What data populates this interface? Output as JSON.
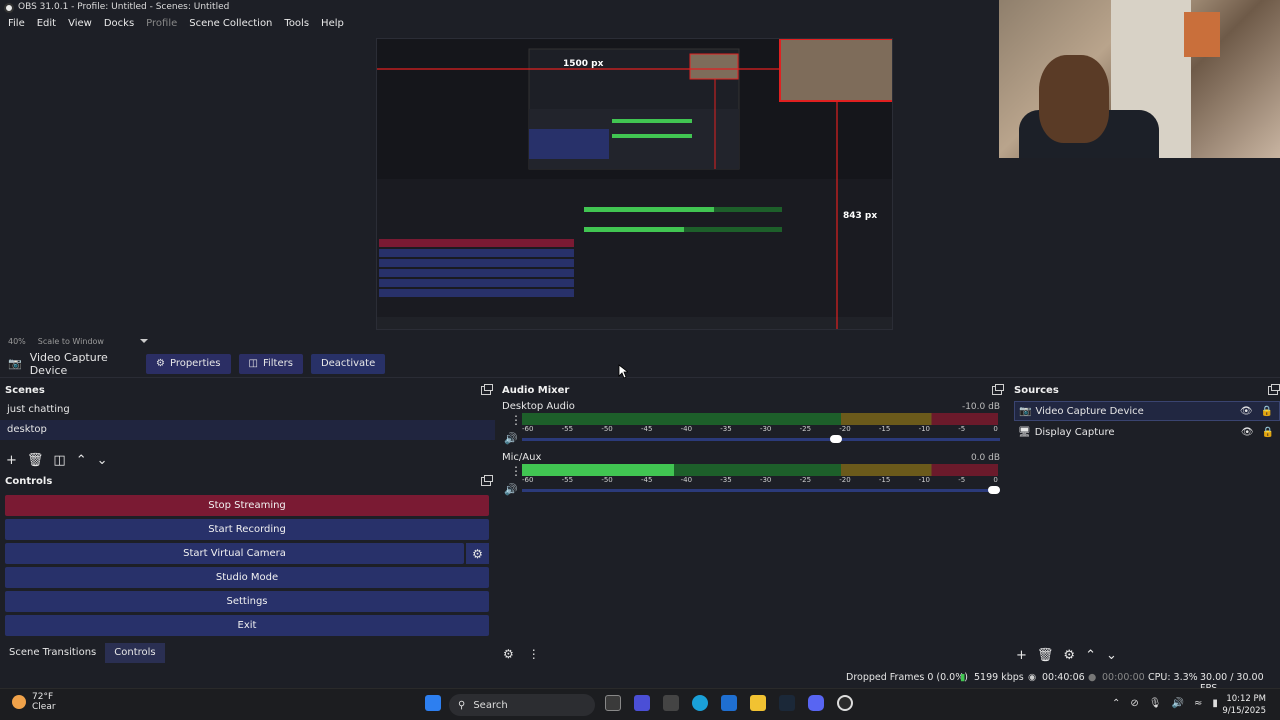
{
  "window": {
    "title": "OBS 31.0.1 - Profile: Untitled - Scenes: Untitled"
  },
  "menu": [
    "File",
    "Edit",
    "View",
    "Docks",
    "Profile",
    "Scene Collection",
    "Tools",
    "Help"
  ],
  "preview": {
    "zoom": "40%",
    "scale_mode": "Scale to Window",
    "mirror_labels": {
      "width": "1500 px",
      "height": "843 px"
    }
  },
  "source_toolbar": {
    "current_source": "Video Capture Device",
    "properties": "Properties",
    "filters": "Filters",
    "deactivate": "Deactivate"
  },
  "scenes": {
    "title": "Scenes",
    "items": [
      "just chatting",
      "desktop"
    ]
  },
  "controls": {
    "title": "Controls",
    "buttons": [
      "Stop Streaming",
      "Start Recording",
      "Start Virtual Camera",
      "Studio Mode",
      "Settings",
      "Exit"
    ]
  },
  "bottom_tabs": [
    "Scene Transitions",
    "Controls"
  ],
  "mixer": {
    "title": "Audio Mixer",
    "channels": [
      {
        "name": "Desktop Audio",
        "db": "-10.0 dB",
        "level": 0.0,
        "volume": 0.66
      },
      {
        "name": "Mic/Aux",
        "db": "0.0 dB",
        "level": 0.32,
        "volume": 1.0
      }
    ],
    "ticks": [
      "-60",
      "-55",
      "-50",
      "-45",
      "-40",
      "-35",
      "-30",
      "-25",
      "-20",
      "-15",
      "-10",
      "-5",
      "0"
    ]
  },
  "sources": {
    "title": "Sources",
    "items": [
      "Video Capture Device",
      "Display Capture"
    ]
  },
  "status": {
    "dropped": "Dropped Frames 0 (0.0%)",
    "bitrate": "5199 kbps",
    "stream_time": "00:40:06",
    "rec_time": "00:00:00",
    "cpu": "CPU: 3.3%",
    "fps": "30.00 / 30.00 FPS"
  },
  "taskbar": {
    "weather_temp": "72°F",
    "weather_desc": "Clear",
    "search": "Search",
    "time": "10:12 PM",
    "date": "9/15/2025"
  },
  "colors": {
    "accent_button": "#28316a",
    "stop_button": "#7a1a33",
    "meter_green": "#41c552",
    "selection_red": "#e02020"
  }
}
